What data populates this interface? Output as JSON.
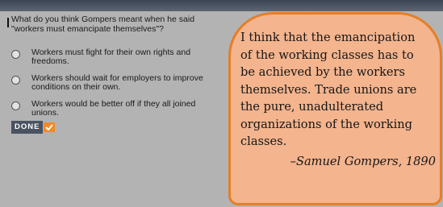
{
  "question": {
    "prompt": "What do you think Gompers meant when he said \"workers must emancipate themselves\"?",
    "options": [
      {
        "label": "Workers must fight for their own rights and freedoms."
      },
      {
        "label": "Workers should wait for employers to improve conditions on their own."
      },
      {
        "label": "Workers would be better off if they all joined unions."
      }
    ],
    "done_label": "DONE"
  },
  "quote": {
    "text": "I think that the emancipation\nof the working classes has to\nbe achieved by the workers\nthemselves. Trade unions are\nthe pure, unadulterated\norganizations of the working\nclasses.",
    "attribution": "–Samuel Gompers, 1890"
  },
  "colors": {
    "card_fill": "#f3b48e",
    "card_border": "#e57e27",
    "done_bg": "#4a5361",
    "check_bg": "#f08a2a"
  },
  "icons": {
    "done": "check-icon",
    "radio": "radio-circle"
  }
}
